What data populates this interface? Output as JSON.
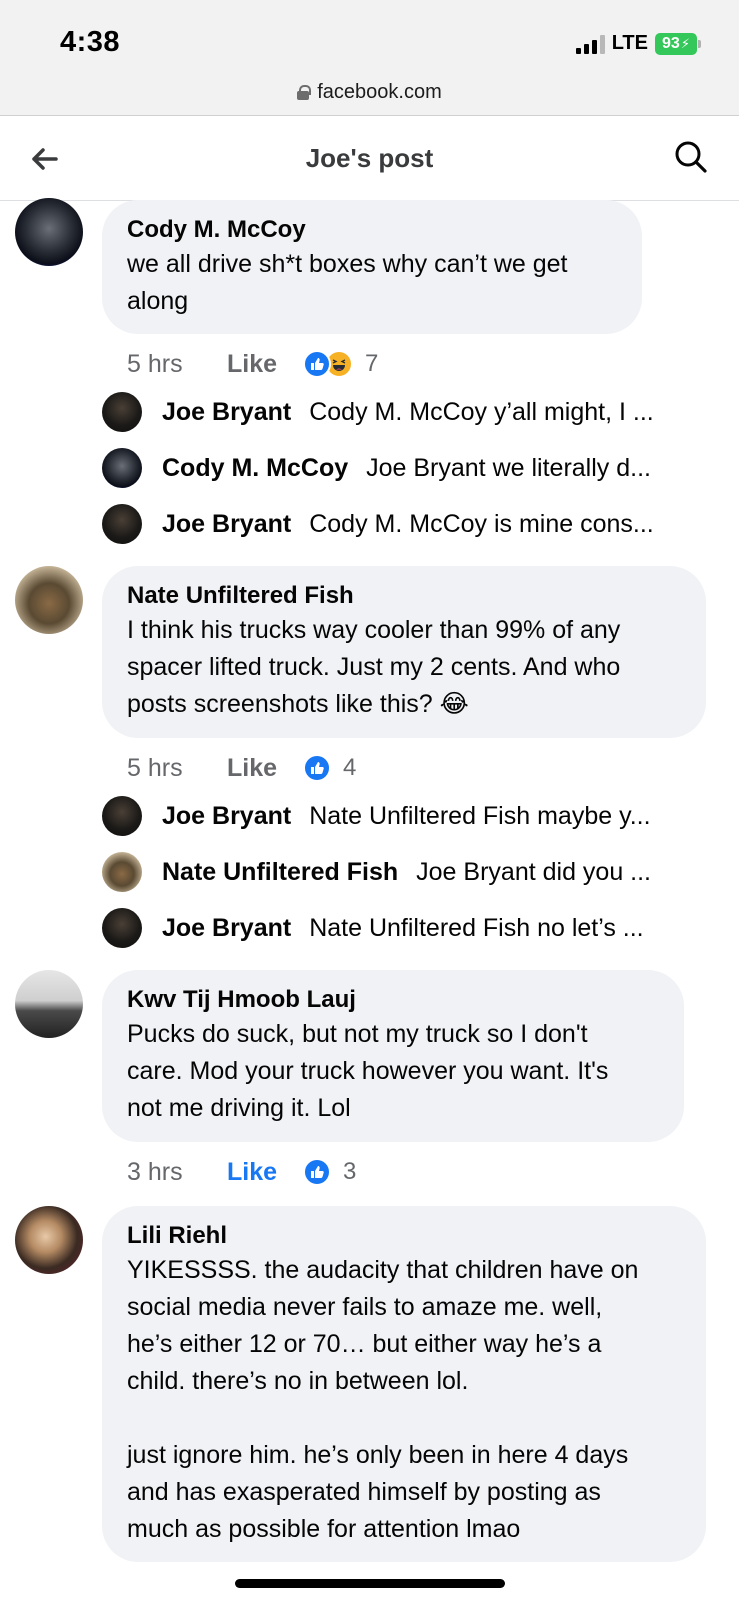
{
  "status_bar": {
    "time": "4:38",
    "network": "LTE",
    "battery": "93"
  },
  "url_bar": {
    "url": "facebook.com"
  },
  "header": {
    "title": "Joe's post"
  },
  "colors": {
    "accent": "#1877f2",
    "bubble": "#f0f2f5",
    "battery": "#34c759",
    "meta": "#65676b"
  },
  "comments": [
    {
      "author": "Cody M. McCoy",
      "lines": [
        "we all drive sh*t boxes why can’t we get",
        "along"
      ],
      "time": "5 hrs",
      "like_label": "Like",
      "reactions": [
        "like-icon",
        "haha-icon"
      ],
      "reaction_count": "7",
      "replies": [
        {
          "author": "Joe Bryant",
          "text": "Cody M. McCoy y’all might, I ..."
        },
        {
          "author": "Cody M. McCoy",
          "text": "Joe Bryant we literally d..."
        },
        {
          "author": "Joe Bryant",
          "text": "Cody M. McCoy is mine cons..."
        }
      ]
    },
    {
      "author": "Nate Unfiltered Fish",
      "lines": [
        "I think his trucks way cooler than 99% of any",
        "spacer lifted truck. Just my 2 cents. And who",
        "posts screenshots like this? 😂"
      ],
      "time": "5 hrs",
      "like_label": "Like",
      "reactions": [
        "like-icon"
      ],
      "reaction_count": "4",
      "replies": [
        {
          "author": "Joe Bryant",
          "text": "Nate Unfiltered Fish maybe y..."
        },
        {
          "author": "Nate Unfiltered Fish",
          "text": "Joe Bryant did you ..."
        },
        {
          "author": "Joe Bryant",
          "text": "Nate Unfiltered Fish no let’s ..."
        }
      ]
    },
    {
      "author": "Kwv Tij Hmoob Lauj",
      "lines": [
        "Pucks do suck, but not my truck so I don't",
        "care. Mod your truck however you want. It's",
        "not me driving it. Lol"
      ],
      "time": "3 hrs",
      "like_label": "Like",
      "liked": true,
      "reactions": [
        "like-icon"
      ],
      "reaction_count": "3",
      "replies": []
    },
    {
      "author": "Lili Riehl",
      "lines": [
        "YIKESSSS. the audacity that children have on",
        "social media never fails to amaze me. well,",
        "he’s either 12 or 70… but either way he’s a",
        "child. there’s no in between lol.",
        "",
        "just ignore him. he’s only been in here 4 days",
        "and has exasperated himself by posting as",
        "much as possible for attention lmao"
      ],
      "replies": []
    }
  ]
}
